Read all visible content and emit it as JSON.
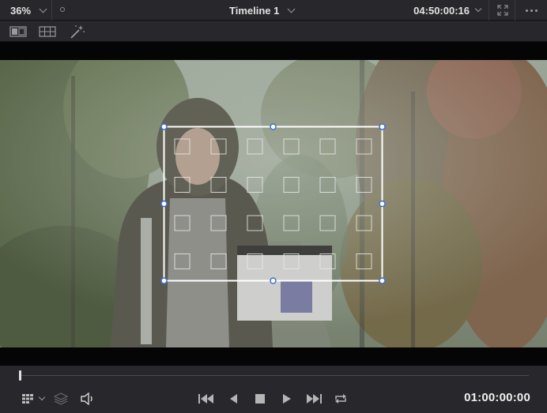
{
  "topbar": {
    "zoom": "36%",
    "timeline_name": "Timeline 1",
    "source_timecode": "04:50:00:16"
  },
  "toolbar": {
    "icons": [
      "split-view-icon",
      "grid-view-icon",
      "magic-wand-icon"
    ]
  },
  "viewer": {
    "overlay": "transform-box-with-tracking-grid",
    "grid": {
      "rows": 4,
      "cols": 6
    }
  },
  "transport": {
    "playhead_fraction": 0.0,
    "timecode": "01:00:00:00",
    "icons": [
      "viewer-grid-icon",
      "layers-icon",
      "volume-icon",
      "skip-to-start-icon",
      "step-back-icon",
      "stop-icon",
      "play-icon",
      "skip-to-end-icon",
      "loop-icon"
    ]
  },
  "colors": {
    "panel": "#28282c",
    "background": "#1f1f22",
    "handle": "#3e6fd8",
    "text": "#e2e2e2"
  }
}
